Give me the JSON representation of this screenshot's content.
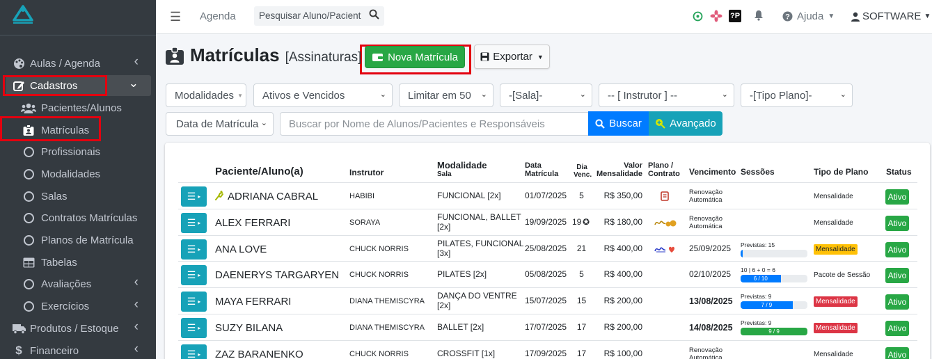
{
  "brand_color": "#17a2b8",
  "sidebar": {
    "items": [
      {
        "label": "Aulas / Agenda",
        "icon": "palette-icon",
        "has_arrow": true
      },
      {
        "label": "Cadastros",
        "icon": "edit-icon",
        "has_arrow": true,
        "active": true
      },
      {
        "label": "Pacientes/Alunos",
        "icon": "users-icon",
        "sub": true
      },
      {
        "label": "Matrículas",
        "icon": "id-badge-icon",
        "sub": true
      },
      {
        "label": "Profissionais",
        "icon": "circle-icon",
        "sub": true
      },
      {
        "label": "Modalidades",
        "icon": "circle-icon",
        "sub": true
      },
      {
        "label": "Salas",
        "icon": "circle-icon",
        "sub": true
      },
      {
        "label": "Contratos Matrículas",
        "icon": "circle-icon",
        "sub": true
      },
      {
        "label": "Planos de Matrícula",
        "icon": "circle-icon",
        "sub": true
      },
      {
        "label": "Tabelas",
        "icon": "table-icon",
        "sub": true
      },
      {
        "label": "Avaliações",
        "icon": "circle-icon",
        "sub": true,
        "has_arrow": true
      },
      {
        "label": "Exercícios",
        "icon": "circle-icon",
        "sub": true,
        "has_arrow": true
      },
      {
        "label": "Produtos / Estoque",
        "icon": "truck-icon",
        "has_arrow": true
      },
      {
        "label": "Financeiro",
        "icon": "dollar-icon",
        "has_arrow": true
      }
    ]
  },
  "topbar": {
    "agenda": "Agenda",
    "search_placeholder": "Pesquisar Aluno/Pacient",
    "help": "Ajuda",
    "user": "SOFTWARE"
  },
  "page": {
    "title": "Matrículas",
    "subtitle": "[Assinaturas]",
    "new_button": "Nova Matrícula",
    "export_button": "Exportar"
  },
  "filters": {
    "modalidades": "Modalidades",
    "status": "Ativos e Vencidos",
    "limit": "Limitar em 50",
    "sala": "-[Sala]-",
    "instrutor": "-- [ Instrutor ] --",
    "tipo_plano": "-[Tipo Plano]-",
    "data": "Data de Matrícula",
    "search_placeholder": "Buscar por Nome de Alunos/Pacientes e Responsáveis",
    "buscar": "Buscar",
    "avancado": "Avançado"
  },
  "table": {
    "headers": {
      "paciente": "Paciente/Aluno(a)",
      "instrutor": "Instrutor",
      "modalidade": "Modalidade",
      "sala": "Sala",
      "data1": "Data",
      "data2": "Matrícula",
      "dia1": "Dia",
      "dia2": "Venc.",
      "valor1": "Valor",
      "valor2": "Mensalidade",
      "plano1": "Plano /",
      "plano2": "Contrato",
      "vencimento": "Vencimento",
      "sessoes": "Sessões",
      "tipo": "Tipo de Plano",
      "status": "Status"
    },
    "rows": [
      {
        "name": "ADRIANA CABRAL",
        "instrutor": "HABIBI",
        "mod1": "FUNCIONAL [2x]",
        "mod2": "",
        "data": "01/07/2025",
        "dia": "5",
        "valor": "R$ 350,00",
        "plano": "doc",
        "venc1": "Renovação",
        "venc2": "Automática",
        "sess": null,
        "tipo": "Mensalidade",
        "tipo_style": "plain",
        "status": "Ativo"
      },
      {
        "name": "ALEX FERRARI",
        "instrutor": "SORAYA",
        "mod1": "FUNCIONAL, BALLET",
        "mod2": "[2x]",
        "data": "19/09/2025",
        "dia": "19",
        "valor": "R$ 180,00",
        "plano": "sig-gold",
        "venc1": "Renovação",
        "venc2": "Automática",
        "sess": null,
        "tipo": "Mensalidade",
        "tipo_style": "plain",
        "status": "Ativo"
      },
      {
        "name": "ANA LOVE",
        "instrutor": "CHUCK NORRIS",
        "mod1": "PILATES, FUNCIONAL",
        "mod2": "[3x]",
        "data": "25/08/2025",
        "dia": "21",
        "valor": "R$ 400,00",
        "plano": "sig-red",
        "venc1": "25/09/2025",
        "venc2": "",
        "sess": {
          "label": "Previstas: 15",
          "text": "",
          "pct": 3,
          "color": "#007bff"
        },
        "tipo": "Mensalidade",
        "tipo_style": "yellow",
        "status": "Ativo"
      },
      {
        "name": "DAENERYS TARGARYEN",
        "instrutor": "CHUCK NORRIS",
        "mod1": "PILATES [2x]",
        "mod2": "",
        "data": "05/08/2025",
        "dia": "5",
        "valor": "R$ 400,00",
        "plano": "",
        "venc1": "02/10/2025",
        "venc2": "",
        "sess": {
          "label": "10 | 6 + 0 = 6",
          "text": "6 / 10",
          "pct": 60,
          "color": "#007bff"
        },
        "tipo": "Pacote de Sessão",
        "tipo_style": "plain",
        "status": "Ativo"
      },
      {
        "name": "MAYA FERRARI",
        "instrutor": "DIANA THEMISCYRA",
        "mod1": "DANÇA DO VENTRE",
        "mod2": "[2x]",
        "data": "15/07/2025",
        "dia": "15",
        "valor": "R$ 200,00",
        "plano": "",
        "venc1": "13/08/2025",
        "venc2": "",
        "venc_bold": true,
        "sess": {
          "label": "Previstas: 9",
          "text": "7 / 9",
          "pct": 78,
          "color": "#007bff"
        },
        "tipo": "Mensalidade",
        "tipo_style": "red",
        "status": "Ativo"
      },
      {
        "name": "SUZY BILANA",
        "instrutor": "DIANA THEMISCYRA",
        "mod1": "BALLET [2x]",
        "mod2": "",
        "data": "17/07/2025",
        "dia": "17",
        "valor": "R$ 200,00",
        "plano": "",
        "venc1": "14/08/2025",
        "venc2": "",
        "venc_bold": true,
        "sess": {
          "label": "Previstas: 9",
          "text": "9 / 9",
          "pct": 100,
          "color": "#28a745"
        },
        "tipo": "Mensalidade",
        "tipo_style": "red",
        "status": "Ativo"
      },
      {
        "name": "ZAZ BARANENKO",
        "instrutor": "CHUCK NORRIS",
        "mod1": "CROSSFIT [1x]",
        "mod2": "",
        "data": "17/09/2025",
        "dia": "17",
        "valor": "R$ 100,00",
        "plano": "",
        "venc1": "Renovação",
        "venc2": "Automática",
        "sess": null,
        "tipo": "Mensalidade",
        "tipo_style": "plain",
        "status": "Ativo"
      }
    ]
  }
}
